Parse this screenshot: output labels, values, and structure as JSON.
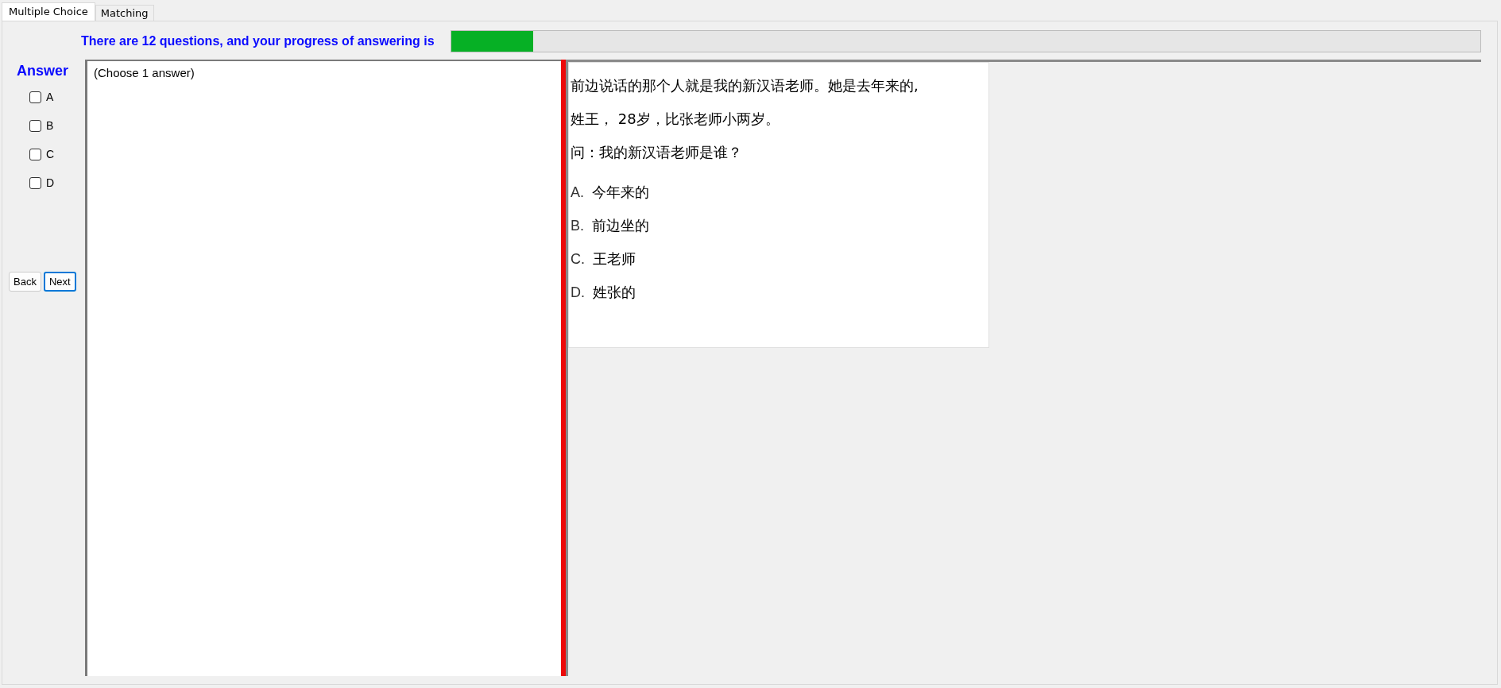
{
  "tabs": [
    {
      "label": "Multiple Choice",
      "selected": true
    },
    {
      "label": "Matching",
      "selected": false
    }
  ],
  "progress": {
    "text": "There are 12 questions, and your progress of answering is",
    "level": 0.08
  },
  "answer": {
    "title": "Answer",
    "options": [
      {
        "label": "A",
        "checked": false
      },
      {
        "label": "B",
        "checked": false
      },
      {
        "label": "C",
        "checked": false
      },
      {
        "label": "D",
        "checked": false
      }
    ]
  },
  "buttons": [
    {
      "label": "Back",
      "focused": false
    },
    {
      "label": "Next",
      "focused": true
    }
  ],
  "answer_box": {
    "text": "(Choose 1 answer)"
  },
  "question": {
    "lines": [
      "前边说话的那个人就是我的新汉语老师。她是去年来的,",
      "姓王， 28岁，比张老师小两岁。",
      "问：我的新汉语老师是谁？"
    ],
    "choices": [
      {
        "letter": "A.",
        "text": "今年来的"
      },
      {
        "letter": "B.",
        "text": "前边坐的"
      },
      {
        "letter": "C.",
        "text": "王老师"
      },
      {
        "letter": "D.",
        "text": "姓张的"
      }
    ]
  }
}
